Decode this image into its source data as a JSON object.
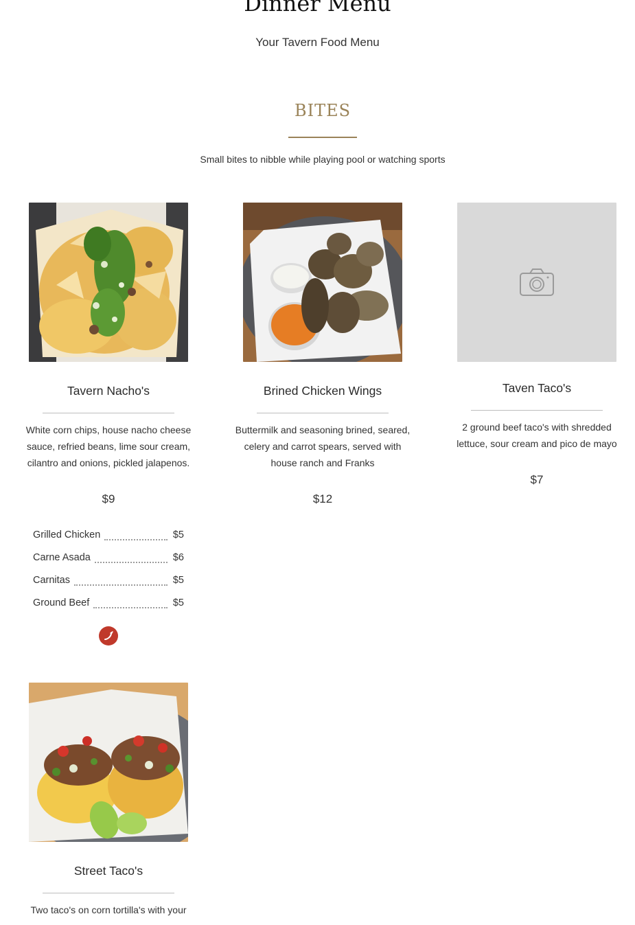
{
  "page": {
    "title": "Dinner Menu",
    "subtitle": "Your Tavern Food Menu"
  },
  "section": {
    "title": "BITES",
    "description": "Small bites to nibble while playing pool or watching sports",
    "accent_color": "#9a8358"
  },
  "items": [
    {
      "name": "Tavern Nacho's",
      "description": "White corn chips, house nacho cheese sauce, refried beans, lime sour cream, cilantro and onions, pickled jalapenos.",
      "price": "$9",
      "image": "nachos-photo",
      "addons": [
        {
          "name": "Grilled Chicken",
          "price": "$5"
        },
        {
          "name": "Carne Asada",
          "price": "$6"
        },
        {
          "name": "Carnitas",
          "price": "$5"
        },
        {
          "name": "Ground Beef",
          "price": "$5"
        }
      ],
      "badge": "chili-pepper-icon"
    },
    {
      "name": "Brined Chicken Wings",
      "description": "Buttermilk and seasoning brined, seared, celery and carrot spears, served with house ranch and Franks",
      "price": "$12",
      "image": "chicken-wings-photo"
    },
    {
      "name": "Taven Taco's",
      "description": "2 ground beef taco's with shredded lettuce, sour cream and pico de mayo",
      "price": "$7",
      "image": "camera-placeholder-icon"
    },
    {
      "name": "Street Taco's",
      "description": "Two taco's on corn tortilla's with your",
      "image": "street-tacos-photo"
    }
  ],
  "colors": {
    "badge": "#c0392b",
    "placeholder": "#d9d9d9"
  }
}
